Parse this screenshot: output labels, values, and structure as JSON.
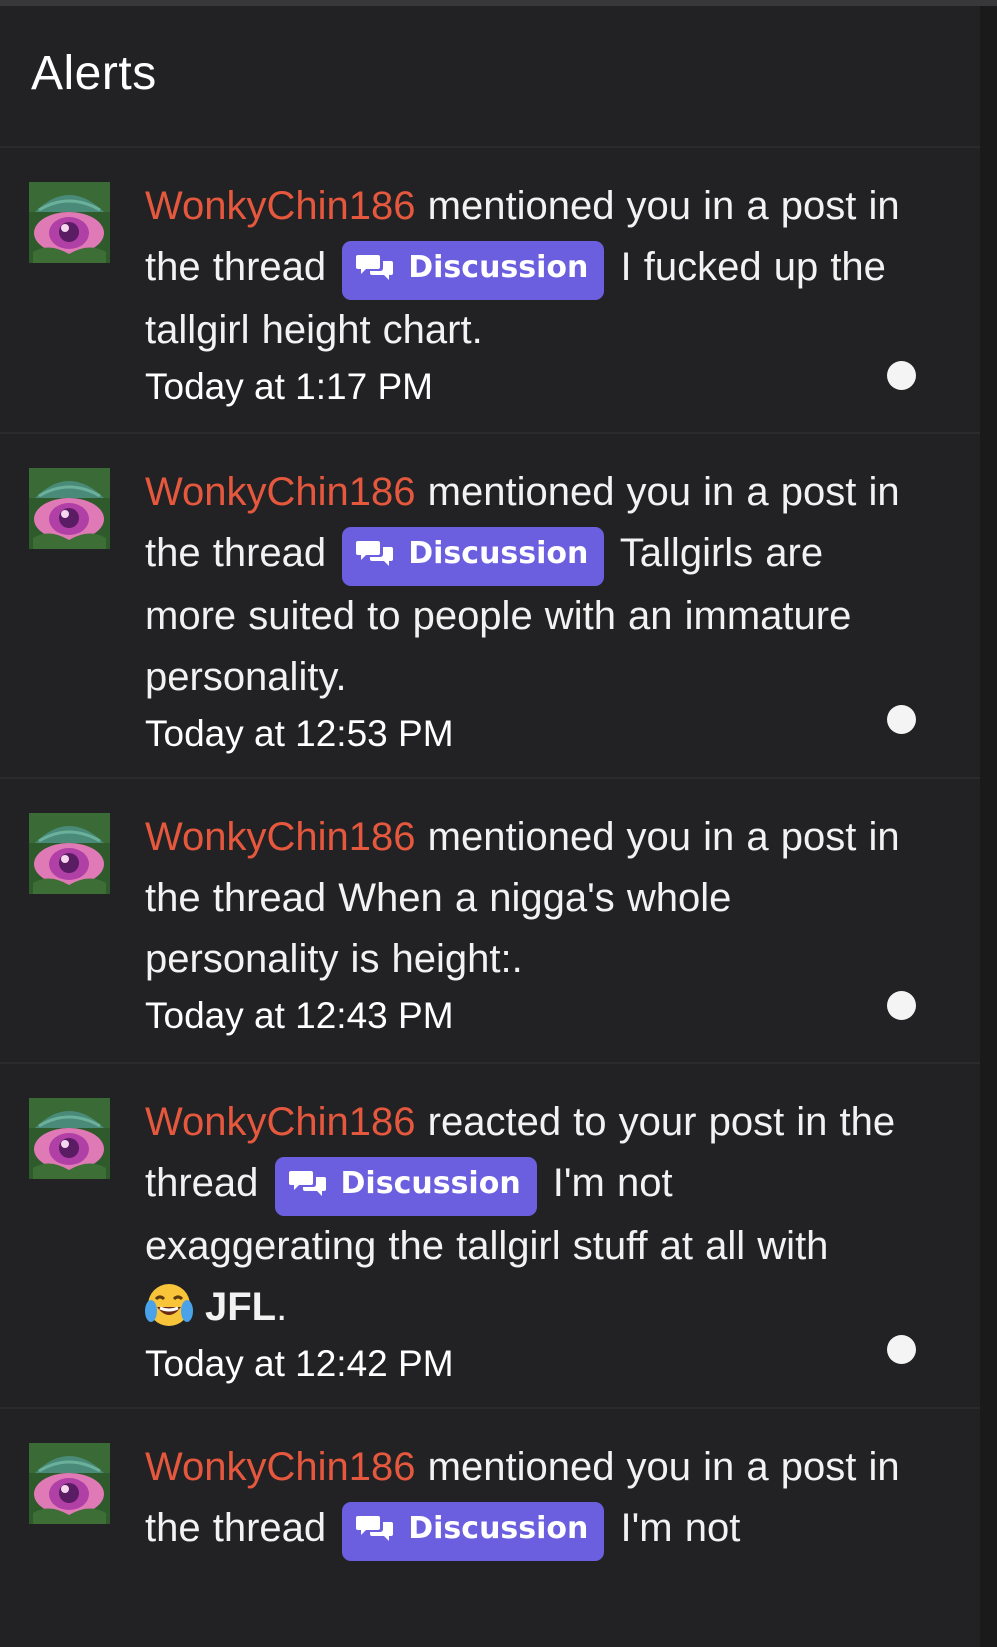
{
  "header": {
    "title": "Alerts"
  },
  "alerts": [
    {
      "username": "WonkyChin186",
      "action": " mentioned you in a post in the thread ",
      "prefix": "Discussion",
      "thread": " I fucked up the tallgirl height chart.",
      "time": "Today at 1:17 PM",
      "unread": true
    },
    {
      "username": "WonkyChin186",
      "action": " mentioned you in a post in the thread ",
      "prefix": "Discussion",
      "thread": " Tallgirls are more suited to people with an immature personality.",
      "time": "Today at 12:53 PM",
      "unread": true
    },
    {
      "username": "WonkyChin186",
      "action": " mentioned you in a post in the thread When a nigga's whole personality is height:.",
      "time": "Today at 12:43 PM",
      "unread": true
    },
    {
      "username": "WonkyChin186",
      "action": " reacted to your post in the thread ",
      "prefix": "Discussion",
      "thread": " I'm not exaggerating the tallgirl stuff at all with ",
      "reaction_icon": "laughing-crying-emoji-icon",
      "reaction": "JFL",
      "tail": ".",
      "time": "Today at 12:42 PM",
      "unread": true
    },
    {
      "username": "WonkyChin186",
      "action": " mentioned you in a post in the thread ",
      "prefix": "Discussion",
      "thread": " I'm not"
    }
  ],
  "colors": {
    "background": "#222224",
    "username": "#e5583e",
    "prefix_badge": "#6b5fe0",
    "text": "#f2f2f2",
    "unread_dot": "#f4f4f4"
  }
}
